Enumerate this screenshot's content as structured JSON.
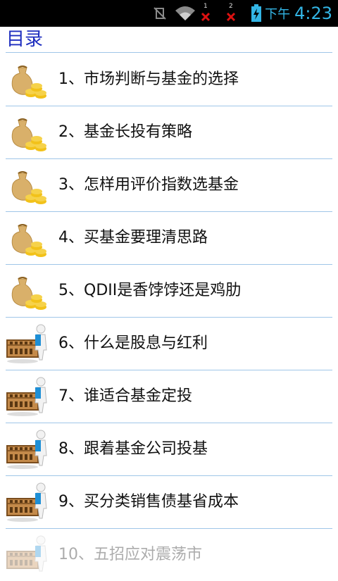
{
  "status_bar": {
    "sim1_number": "1",
    "sim2_number": "2",
    "ampm": "下午",
    "time": "4:23",
    "icons": [
      "vibrate-muted-icon",
      "wifi-icon",
      "sim1-no-signal-icon",
      "sim2-no-signal-icon",
      "battery-charging-icon"
    ]
  },
  "page": {
    "title": "目录"
  },
  "colors": {
    "title": "#1d2dbf",
    "status_accent": "#33b5e5",
    "divider": "#9fc6e8"
  },
  "items": [
    {
      "label": "1、市场判断与基金的选择",
      "icon": "money-bag-coins-icon"
    },
    {
      "label": "2、基金长投有策略",
      "icon": "money-bag-coins-icon"
    },
    {
      "label": "3、怎样用评价指数选基金",
      "icon": "money-bag-coins-icon"
    },
    {
      "label": "4、买基金要理清思路",
      "icon": "money-bag-coins-icon"
    },
    {
      "label": "5、QDII是香饽饽还是鸡肋",
      "icon": "money-bag-coins-icon"
    },
    {
      "label": "6、什么是股息与红利",
      "icon": "abacus-figure-icon"
    },
    {
      "label": "7、谁适合基金定投",
      "icon": "abacus-figure-icon"
    },
    {
      "label": "8、跟着基金公司投基",
      "icon": "abacus-figure-icon"
    },
    {
      "label": "9、买分类销售债基省成本",
      "icon": "abacus-figure-icon"
    },
    {
      "label": "10、五招应对震荡市",
      "icon": "abacus-figure-icon"
    }
  ]
}
